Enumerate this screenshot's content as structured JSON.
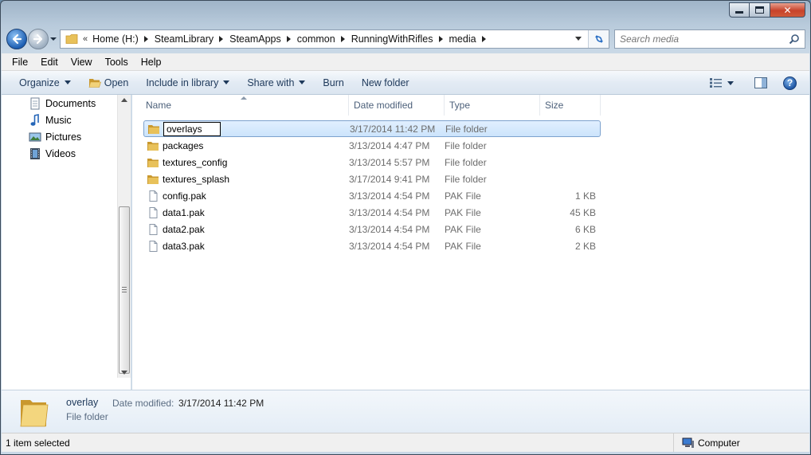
{
  "window": {
    "title": "",
    "close_label": "✕"
  },
  "navigation": {
    "address_prefix": "«",
    "breadcrumbs": [
      "Home (H:)",
      "SteamLibrary",
      "SteamApps",
      "common",
      "RunningWithRifles",
      "media"
    ],
    "search_placeholder": "Search media"
  },
  "menu": [
    "File",
    "Edit",
    "View",
    "Tools",
    "Help"
  ],
  "commands": {
    "organize": "Organize",
    "open": "Open",
    "include_in_library": "Include in library",
    "share_with": "Share with",
    "burn": "Burn",
    "new_folder": "New folder",
    "help": "?"
  },
  "nav_pane": {
    "items": [
      {
        "label": "Documents",
        "icon": "documents-icon"
      },
      {
        "label": "Music",
        "icon": "music-icon"
      },
      {
        "label": "Pictures",
        "icon": "pictures-icon"
      },
      {
        "label": "Videos",
        "icon": "videos-icon"
      }
    ]
  },
  "file_list": {
    "columns": {
      "name": "Name",
      "date": "Date modified",
      "type": "Type",
      "size": "Size"
    },
    "rename_value": "overlays",
    "rows": [
      {
        "name": "overlays",
        "date": "3/17/2014 11:42 PM",
        "type": "File folder",
        "size": "",
        "kind": "folder",
        "selected": true
      },
      {
        "name": "packages",
        "date": "3/13/2014 4:47 PM",
        "type": "File folder",
        "size": "",
        "kind": "folder"
      },
      {
        "name": "textures_config",
        "date": "3/13/2014 5:57 PM",
        "type": "File folder",
        "size": "",
        "kind": "folder"
      },
      {
        "name": "textures_splash",
        "date": "3/17/2014 9:41 PM",
        "type": "File folder",
        "size": "",
        "kind": "folder"
      },
      {
        "name": "config.pak",
        "date": "3/13/2014 4:54 PM",
        "type": "PAK File",
        "size": "1 KB",
        "kind": "file"
      },
      {
        "name": "data1.pak",
        "date": "3/13/2014 4:54 PM",
        "type": "PAK File",
        "size": "45 KB",
        "kind": "file"
      },
      {
        "name": "data2.pak",
        "date": "3/13/2014 4:54 PM",
        "type": "PAK File",
        "size": "6 KB",
        "kind": "file"
      },
      {
        "name": "data3.pak",
        "date": "3/13/2014 4:54 PM",
        "type": "PAK File",
        "size": "2 KB",
        "kind": "file"
      }
    ]
  },
  "details": {
    "name": "overlay",
    "date_label": "Date modified:",
    "date_value": "3/17/2014 11:42 PM",
    "type": "File folder"
  },
  "status": {
    "selection": "1 item selected",
    "location": "Computer"
  },
  "colors": {
    "folder": "#e8c15a",
    "folder_dark": "#c9982e",
    "selection_border": "#7da2ce"
  }
}
